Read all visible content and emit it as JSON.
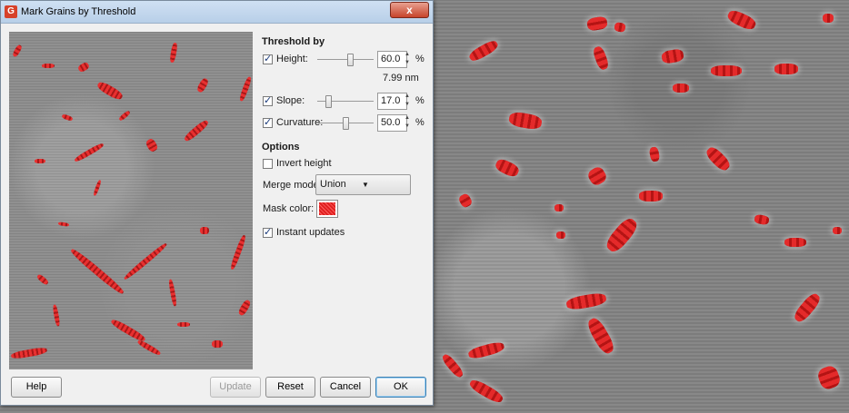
{
  "window": {
    "title": "Mark Grains by Threshold",
    "app_icon_letter": "G",
    "close_label": "x"
  },
  "threshold": {
    "section_title": "Threshold by",
    "height": {
      "label": "Height:",
      "checked": true,
      "value": "60.0",
      "unit": "%",
      "abs_value": "7.99 nm",
      "level": 0.6
    },
    "slope": {
      "label": "Slope:",
      "checked": true,
      "value": "17.0",
      "unit": "%",
      "level": 0.17
    },
    "curvature": {
      "label": "Curvature:",
      "checked": true,
      "value": "50.0",
      "unit": "%",
      "level": 0.5
    }
  },
  "options": {
    "section_title": "Options",
    "invert_height": {
      "label": "Invert height",
      "checked": false
    },
    "merge_mode": {
      "label": "Merge mode:",
      "value": "Union"
    },
    "mask_color": {
      "label": "Mask color:",
      "color": "#e02020"
    },
    "instant_updates": {
      "label": "Instant updates",
      "checked": true
    }
  },
  "buttons": {
    "help": "Help",
    "update": "Update",
    "reset": "Reset",
    "cancel": "Cancel",
    "ok": "OK"
  },
  "icons": {
    "close": "close-icon",
    "dropdown": "chevron-down-icon",
    "spin": "spin-arrows-icon"
  }
}
